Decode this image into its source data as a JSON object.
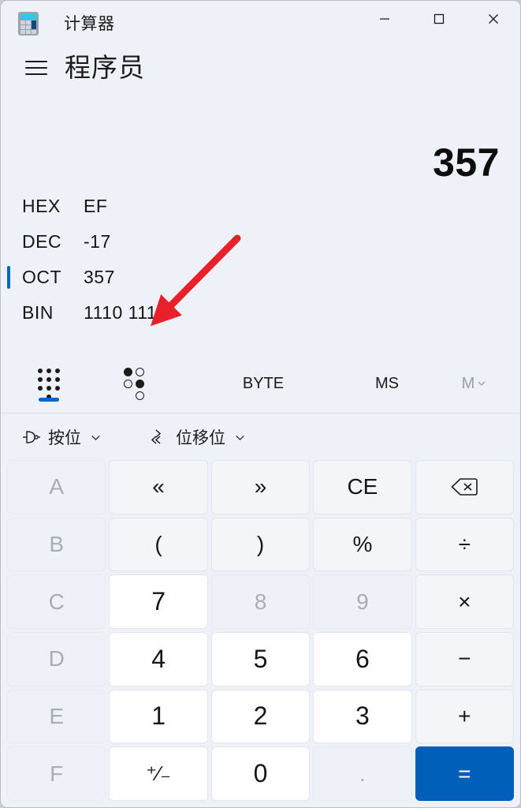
{
  "window": {
    "app_title": "计算器",
    "app_icon": "calculator-icon",
    "controls": {
      "minimize": "minimize-icon",
      "maximize": "maximize-icon",
      "close": "close-icon"
    }
  },
  "mode_header": {
    "menu_icon": "hamburger-menu-icon",
    "title": "程序员"
  },
  "display": {
    "main_value": "357",
    "radix_rows": [
      {
        "label": "HEX",
        "value": "EF",
        "selected": false
      },
      {
        "label": "DEC",
        "value": "-17",
        "selected": false
      },
      {
        "label": "OCT",
        "value": "357",
        "selected": true
      },
      {
        "label": "BIN",
        "value": "1110 1111",
        "selected": false
      }
    ]
  },
  "toolbar": {
    "keypad_icon": "keypad-icon",
    "bit_toggle_icon": "bit-toggle-keypad-icon",
    "word_size": "BYTE",
    "memory_store": "MS",
    "memory_dropdown": "M",
    "memory_dropdown_disabled": true
  },
  "function_dropdowns": [
    {
      "icon": "logic-gate-icon",
      "label": "按位",
      "chevron": "⌄"
    },
    {
      "icon": "bit-shift-icon",
      "label": "位移位",
      "chevron": "⌄"
    }
  ],
  "keypad": {
    "rows": [
      [
        {
          "name": "key-a",
          "label": "A",
          "type": "hex",
          "disabled": true
        },
        {
          "name": "key-lshift",
          "label": "«",
          "type": "op",
          "disabled": false
        },
        {
          "name": "key-rshift",
          "label": "»",
          "type": "op",
          "disabled": false
        },
        {
          "name": "key-ce",
          "label": "CE",
          "type": "op",
          "disabled": false
        },
        {
          "name": "key-backspace",
          "label": "",
          "type": "icon",
          "icon": "backspace-icon",
          "disabled": false
        }
      ],
      [
        {
          "name": "key-b",
          "label": "B",
          "type": "hex",
          "disabled": true
        },
        {
          "name": "key-paren-open",
          "label": "(",
          "type": "op",
          "disabled": false
        },
        {
          "name": "key-paren-close",
          "label": ")",
          "type": "op",
          "disabled": false
        },
        {
          "name": "key-percent",
          "label": "%",
          "type": "op",
          "disabled": false
        },
        {
          "name": "key-divide",
          "label": "÷",
          "type": "op",
          "disabled": false
        }
      ],
      [
        {
          "name": "key-c",
          "label": "C",
          "type": "hex",
          "disabled": true
        },
        {
          "name": "key-7",
          "label": "7",
          "type": "num",
          "disabled": false
        },
        {
          "name": "key-8",
          "label": "8",
          "type": "num",
          "disabled": true
        },
        {
          "name": "key-9",
          "label": "9",
          "type": "num",
          "disabled": true
        },
        {
          "name": "key-multiply",
          "label": "×",
          "type": "op",
          "disabled": false
        }
      ],
      [
        {
          "name": "key-d",
          "label": "D",
          "type": "hex",
          "disabled": true
        },
        {
          "name": "key-4",
          "label": "4",
          "type": "num",
          "disabled": false
        },
        {
          "name": "key-5",
          "label": "5",
          "type": "num",
          "disabled": false
        },
        {
          "name": "key-6",
          "label": "6",
          "type": "num",
          "disabled": false
        },
        {
          "name": "key-subtract",
          "label": "−",
          "type": "op",
          "disabled": false
        }
      ],
      [
        {
          "name": "key-e",
          "label": "E",
          "type": "hex",
          "disabled": true
        },
        {
          "name": "key-1",
          "label": "1",
          "type": "num",
          "disabled": false
        },
        {
          "name": "key-2",
          "label": "2",
          "type": "num",
          "disabled": false
        },
        {
          "name": "key-3",
          "label": "3",
          "type": "num",
          "disabled": false
        },
        {
          "name": "key-add",
          "label": "+",
          "type": "op",
          "disabled": false
        }
      ],
      [
        {
          "name": "key-f",
          "label": "F",
          "type": "hex",
          "disabled": true
        },
        {
          "name": "key-negate",
          "label": "⁺∕₋",
          "type": "pm",
          "disabled": false
        },
        {
          "name": "key-0",
          "label": "0",
          "type": "num",
          "disabled": false
        },
        {
          "name": "key-decimal",
          "label": ".",
          "type": "num",
          "disabled": true
        },
        {
          "name": "key-equals",
          "label": "=",
          "type": "equals",
          "disabled": false
        }
      ]
    ]
  },
  "annotation": {
    "type": "arrow",
    "color": "#e8202a",
    "points_to": "BIN"
  },
  "colors": {
    "accent": "#005fb8",
    "selection_bar": "#0067c0",
    "window_bg": "#eef1f8",
    "key_bg": "#f7f9fc",
    "num_key_bg": "#ffffff",
    "disabled_text": "#a9aeb6",
    "annotation_red": "#e8202a"
  }
}
